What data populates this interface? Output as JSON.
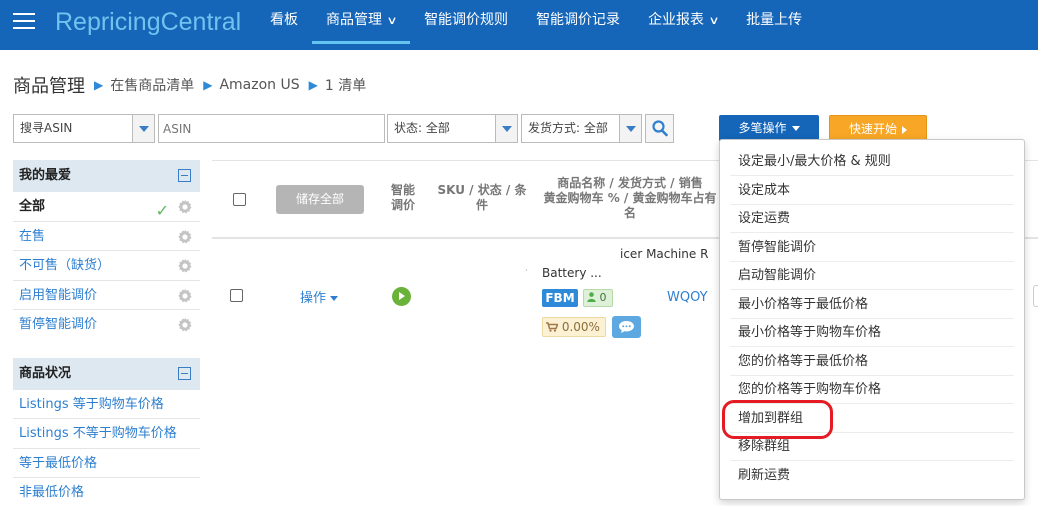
{
  "header": {
    "brand": "RepricingCentral",
    "nav": [
      {
        "label": "看板",
        "caret": false
      },
      {
        "label": "商品管理",
        "caret": true
      },
      {
        "label": "智能调价规则",
        "caret": false
      },
      {
        "label": "智能调价记录",
        "caret": false
      },
      {
        "label": "企业报表",
        "caret": true
      },
      {
        "label": "批量上传",
        "caret": false
      }
    ],
    "active_nav": "商品管理"
  },
  "breadcrumb": {
    "title": "商品管理",
    "items": [
      "在售商品清单",
      "Amazon US",
      "1 清单"
    ]
  },
  "filters": {
    "search_type": "搜寻ASIN",
    "search_placeholder": "ASIN",
    "status": "状态: 全部",
    "shipping": "发货方式: 全部"
  },
  "actions": {
    "multi_label": "多笔操作",
    "quick_label": "快速开始"
  },
  "sidebar": {
    "favorites_title": "我的最爱",
    "favorites": [
      "全部",
      "在售",
      "不可售（缺货）",
      "启用智能调价",
      "暂停智能调价"
    ],
    "selected_favorite": "全部",
    "status_title": "商品状况",
    "status_items": [
      "Listings 等于购物车价格",
      "Listings 不等于购物车价格",
      "等于最低价格",
      "非最低价格"
    ]
  },
  "table": {
    "save_all_label": "储存全部",
    "col_smart": "智能\n调价",
    "col_sku": "SKU / 状态 / 条\n件",
    "col_name_lines": [
      "商品名称 / 发货方式 / 销售",
      "黄金购物车 % / 黄金购物车占有",
      "名"
    ],
    "row": {
      "op_label": "操作",
      "name_fragment": "icer Machine R",
      "battery_fragment": "Battery ...",
      "fulfillment": "FBM",
      "seller_count": "0",
      "buybox_pct": "0.00%",
      "sku_fragment": "WQOY",
      "dot": "·"
    }
  },
  "menu": {
    "items": [
      "设定最小/最大价格 & 规则",
      "设定成本",
      "设定运费",
      "暂停智能调价",
      "启动智能调价",
      "最小价格等于最低价格",
      "最小价格等于购物车价格",
      "您的价格等于最低价格",
      "您的价格等于购物车价格",
      "增加到群组",
      "移除群组",
      "刷新运费"
    ],
    "highlighted": "增加到群组"
  },
  "colors": {
    "nav_bg": "#1565b8",
    "brand": "#6fc3ef",
    "link": "#2e7fd0",
    "quick_button": "#f7a625",
    "highlight_ring": "#e51b24"
  }
}
